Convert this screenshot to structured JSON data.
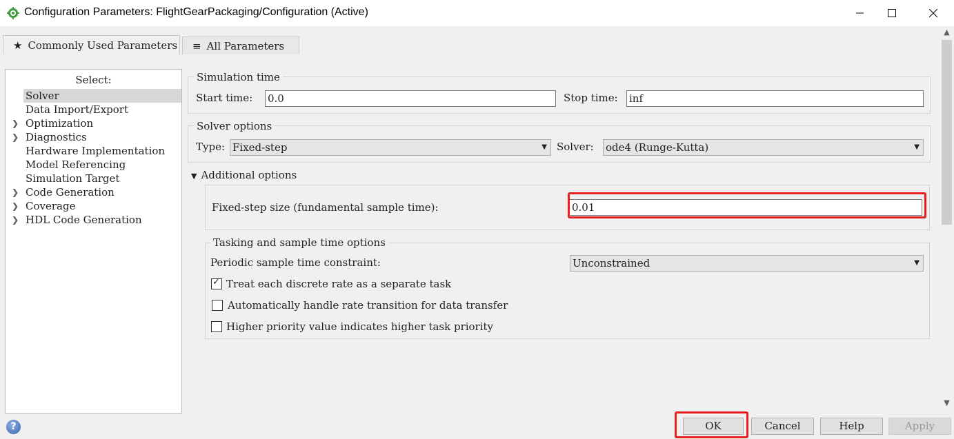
{
  "window": {
    "title": "Configuration Parameters: FlightGearPackaging/Configuration (Active)",
    "icon": "gear-icon",
    "controls": [
      "minimize-icon",
      "maximize-icon",
      "close-icon"
    ]
  },
  "tabs": [
    {
      "label": "Commonly Used Parameters",
      "icon": "★",
      "active": true
    },
    {
      "label": "All Parameters",
      "icon": "≡",
      "active": false
    }
  ],
  "tree": {
    "header": "Select:",
    "items": [
      {
        "label": "Solver",
        "selected": true,
        "expandable": false
      },
      {
        "label": "Data Import/Export",
        "expandable": false
      },
      {
        "label": "Optimization",
        "expandable": true
      },
      {
        "label": "Diagnostics",
        "expandable": true
      },
      {
        "label": "Hardware Implementation",
        "expandable": false
      },
      {
        "label": "Model Referencing",
        "expandable": false
      },
      {
        "label": "Simulation Target",
        "expandable": false
      },
      {
        "label": "Code Generation",
        "expandable": true
      },
      {
        "label": "Coverage",
        "expandable": true
      },
      {
        "label": "HDL Code Generation",
        "expandable": true
      }
    ]
  },
  "simulation_time": {
    "legend": "Simulation time",
    "start_label": "Start time:",
    "start_value": "0.0",
    "stop_label": "Stop time:",
    "stop_value": "inf"
  },
  "solver_options": {
    "legend": "Solver options",
    "type_label": "Type:",
    "type_value": "Fixed-step",
    "solver_label": "Solver:",
    "solver_value": "ode4 (Runge-Kutta)"
  },
  "additional_options": {
    "label": "Additional options",
    "expanded": true,
    "step_size_label": "Fixed-step size (fundamental sample time):",
    "step_size_value": "0.01"
  },
  "tasking": {
    "legend": "Tasking and sample time options",
    "constraint_label": "Periodic sample time constraint:",
    "constraint_value": "Unconstrained",
    "checkboxes": [
      {
        "label": "Treat each discrete rate as a separate task",
        "checked": true
      },
      {
        "label": "Automatically handle rate transition for data transfer",
        "checked": false
      },
      {
        "label": "Higher priority value indicates higher task priority",
        "checked": false
      }
    ]
  },
  "buttons": {
    "ok": "OK",
    "cancel": "Cancel",
    "help": "Help",
    "apply": "Apply"
  },
  "colors": {
    "highlight": "#e81f1f"
  }
}
